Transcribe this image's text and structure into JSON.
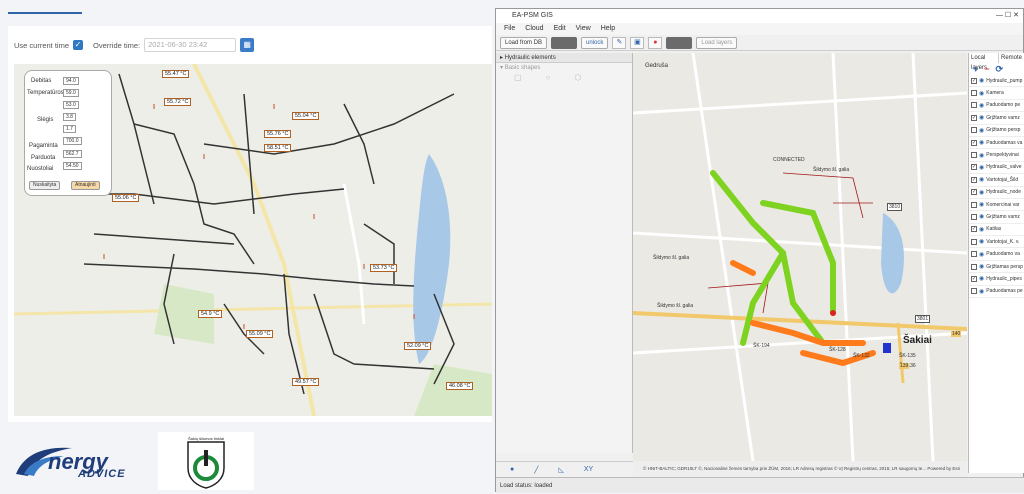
{
  "header": {
    "active_tab": ""
  },
  "controls": {
    "use_current_time_label": "Use current time",
    "use_current_time_checked": true,
    "override_time_label": "Override time:",
    "override_time_value": "2021-06-30 23:42"
  },
  "stats": {
    "debitas_label": "Debitas",
    "debitas_value": "94.0",
    "temperatures_label": "Temperatūros",
    "temp1": "59.0",
    "temp2": "53.0",
    "slegis_label": "Slėgis",
    "slegis1": "3.8",
    "slegis2": "1.7",
    "pagaminta_label": "Pagaminta",
    "pagaminta_value": "700.0",
    "parduota_label": "Parduota",
    "parduota_value": "562.7",
    "nuostoliai_label": "Nuostoliai",
    "nuostoliai_value": "54.50",
    "btn_reset": "Nuskaityta",
    "btn_refresh": "Atnaujinti"
  },
  "temp_labels": [
    "55.47 °C",
    "55.72 °C",
    "55.06 °C",
    "55.76 °C",
    "58.51 °C",
    "55.04 °C",
    "53.73 °C",
    "54.9 °C",
    "55.09 °C",
    "52.09 °C",
    "49.57 °C",
    "46.08 °C"
  ],
  "logos": {
    "company_line1": "nergy",
    "company_line2": "ADVICE",
    "seal_text": "Šakių šilumos tinklai"
  },
  "gis": {
    "title": "EA-PSM GIS",
    "menu": [
      "File",
      "Cloud",
      "Edit",
      "View",
      "Help"
    ],
    "toolbar": {
      "load_from_db": "Load from DB",
      "load_layers": "Load layers",
      "unlock": "unlock"
    },
    "left_panel": {
      "hydraulic_elements": "Hydraulic elements",
      "basic_shapes": "Basic shapes"
    },
    "right_tabs": [
      "Local layers",
      "Remote"
    ],
    "layers": [
      {
        "name": "Hydraulic_pump",
        "checked": true
      },
      {
        "name": "Kamera",
        "checked": false
      },
      {
        "name": "Paduodamo pe",
        "checked": false
      },
      {
        "name": "Grįžtamo vamz",
        "checked": true
      },
      {
        "name": "Grįžtamo persp",
        "checked": false
      },
      {
        "name": "Paduodamas va",
        "checked": true
      },
      {
        "name": "Perspektyvinai",
        "checked": false
      },
      {
        "name": "Hydraulic_valve",
        "checked": true
      },
      {
        "name": "Vartotojai_Šild",
        "checked": true
      },
      {
        "name": "Hydraulic_node",
        "checked": true
      },
      {
        "name": "Komercinai var",
        "checked": false
      },
      {
        "name": "Grįžtamo vamz",
        "checked": false
      },
      {
        "name": "Katilas",
        "checked": true
      },
      {
        "name": "Vartotojai_K. v.",
        "checked": false
      },
      {
        "name": "Paduodamo va",
        "checked": false
      },
      {
        "name": "Grįžtamas persp",
        "checked": false
      },
      {
        "name": "Hydraulic_pipes",
        "checked": true
      },
      {
        "name": "Paduodamas pe",
        "checked": false
      }
    ],
    "map_city": "Šakiai",
    "map_labels": [
      "Gedruša",
      "CONNECTED",
      "Šildymo šl. galia",
      "Šildymo šl. galia",
      "Šildymo šl. galia",
      "ŠK-135",
      "ŠK-136",
      "ŠK-194",
      "ŠK-132",
      "ŠK-128"
    ],
    "road_numbers": [
      "3801",
      "140",
      "139",
      "3810"
    ],
    "copyright": "© HNIT-BALTIC; GDR10LT ©, Nacionalinė žemės tarnyba prie ŽŪM, 2016; LR Adresų registras © VĮ Registrų centras, 2016; LR saugomų te... Powered by Esri",
    "status": "Load status: loaded"
  }
}
